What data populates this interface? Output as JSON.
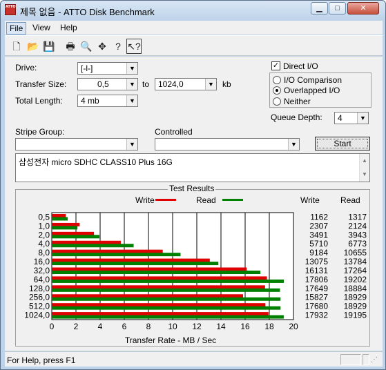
{
  "window": {
    "title": "제목 없음 - ATTO Disk Benchmark",
    "min_glyph": "▁",
    "max_glyph": "□",
    "close_glyph": "✕",
    "icon_text": "ATTO"
  },
  "menu": {
    "items": [
      "File",
      "View",
      "Help"
    ]
  },
  "toolbar": {
    "buttons": [
      "new-icon",
      "open-icon",
      "save-icon",
      "print-icon",
      "print-preview-icon",
      "move-icon",
      "help-icon",
      "context-help-icon"
    ]
  },
  "form": {
    "drive_label": "Drive:",
    "drive_value": "[-l-]",
    "transfer_size_label": "Transfer Size:",
    "transfer_from": "0,5",
    "to_label": "to",
    "transfer_to": "1024,0",
    "kb_label": "kb",
    "total_length_label": "Total Length:",
    "total_length_value": "4 mb",
    "direct_io_label": "Direct I/O",
    "direct_io_checked": true,
    "io_options": [
      "I/O Comparison",
      "Overlapped I/O",
      "Neither"
    ],
    "io_selected": "Overlapped I/O",
    "queue_depth_label": "Queue Depth:",
    "queue_depth_value": "4",
    "stripe_group_label": "Stripe Group:",
    "stripe_group_value": "",
    "controlled_label": "Controlled",
    "controlled_value": "",
    "start_label": "Start",
    "description": "삼성전자 micro SDHC CLASS10 Plus 16G"
  },
  "results": {
    "title": "Test Results",
    "write_label": "Write",
    "read_label": "Read",
    "write_column": "Write",
    "read_column": "Read"
  },
  "chart_data": {
    "type": "bar",
    "orientation": "horizontal",
    "categories": [
      "0,5",
      "1,0",
      "2,0",
      "4,0",
      "8,0",
      "16,0",
      "32,0",
      "64,0",
      "128,0",
      "256,0",
      "512,0",
      "1024,0"
    ],
    "series": [
      {
        "name": "Write",
        "color": "#e00000",
        "values": [
          1162,
          2307,
          3491,
          5710,
          9184,
          13075,
          16131,
          17806,
          17649,
          15827,
          17680,
          17932
        ]
      },
      {
        "name": "Read",
        "color": "#008000",
        "values": [
          1317,
          2124,
          3943,
          6773,
          10655,
          13784,
          17264,
          19202,
          18884,
          18929,
          18929,
          19195
        ]
      }
    ],
    "xlabel": "Transfer Rate - MB / Sec",
    "ylabel": "",
    "x_ticks": [
      "0",
      "2",
      "4",
      "6",
      "8",
      "10",
      "12",
      "14",
      "16",
      "18",
      "20"
    ],
    "xlim": [
      0,
      20
    ],
    "value_unit_divisor": 1000,
    "grid": true,
    "legend": "top"
  },
  "status": {
    "text": "For Help, press F1"
  }
}
